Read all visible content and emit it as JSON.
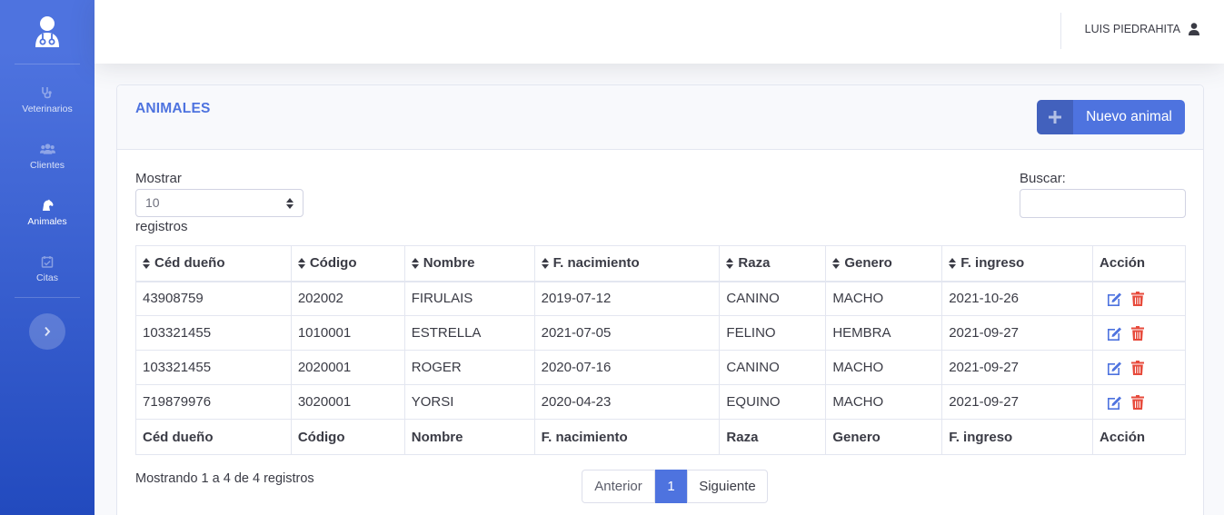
{
  "sidebar": {
    "brand_icon": "vet-doctor-icon",
    "items": [
      {
        "label": "Veterinarios",
        "icon": "stethoscope-icon",
        "active": false
      },
      {
        "label": "Clientes",
        "icon": "users-icon",
        "active": false
      },
      {
        "label": "Animales",
        "icon": "horse-icon",
        "active": true
      },
      {
        "label": "Citas",
        "icon": "calendar-check-icon",
        "active": false
      }
    ],
    "toggle_icon": "chevron-right-icon"
  },
  "topbar": {
    "user_name": "LUIS PIEDRAHITA",
    "user_icon": "user-icon"
  },
  "card": {
    "title": "ANIMALES",
    "new_button_label": "Nuevo animal",
    "new_button_icon": "plus-icon"
  },
  "controls": {
    "show_label": "Mostrar",
    "page_size": "10",
    "records_label": "registros",
    "search_label": "Buscar:",
    "search_value": ""
  },
  "table": {
    "columns": [
      "Céd dueño",
      "Código",
      "Nombre",
      "F. nacimiento",
      "Raza",
      "Genero",
      "F. ingreso",
      "Acción"
    ],
    "rows": [
      [
        "43908759",
        "202002",
        "FIRULAIS",
        "2019-07-12",
        "CANINO",
        "MACHO",
        "2021-10-26"
      ],
      [
        "103321455",
        "1010001",
        "ESTRELLA",
        "2021-07-05",
        "FELINO",
        "HEMBRA",
        "2021-09-27"
      ],
      [
        "103321455",
        "2020001",
        "ROGER",
        "2020-07-16",
        "CANINO",
        "MACHO",
        "2021-09-27"
      ],
      [
        "719879976",
        "3020001",
        "YORSI",
        "2020-04-23",
        "EQUINO",
        "MACHO",
        "2021-09-27"
      ]
    ],
    "row_actions": [
      "edit-icon",
      "trash-icon"
    ]
  },
  "footer": {
    "info": "Mostrando 1 a 4 de 4 registros",
    "prev_label": "Anterior",
    "current_page": "1",
    "next_label": "Siguiente"
  },
  "colors": {
    "primary": "#4e73df",
    "danger": "#e74a3b"
  }
}
